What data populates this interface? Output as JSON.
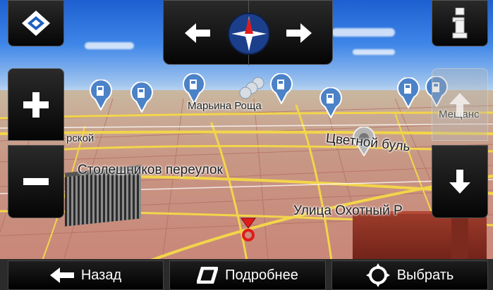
{
  "map": {
    "labels": {
      "marina_roshcha": "Марьина Роща",
      "meshchansky": "Мещанс",
      "left_partial": "рской",
      "tsvetnoy": "Цветной буль",
      "stoleshnikov": "Столешников переулок",
      "okhotny": "Улица Охотный Р"
    }
  },
  "nav": {
    "bottom": {
      "back_label": "Назад",
      "details_label": "Подробнее",
      "select_label": "Выбрать"
    }
  },
  "icons": {
    "menu": "menu-logo-icon",
    "info": "info-icon",
    "zoom_in": "plus-icon",
    "zoom_out": "minus-icon",
    "compass": "compass-icon",
    "rotate_left": "arrow-left-icon",
    "rotate_right": "arrow-right-icon",
    "tilt_up": "arrow-up-icon",
    "tilt_down": "arrow-down-icon",
    "poi": "fuel-station-icon",
    "cursor": "map-cursor-icon"
  },
  "colors": {
    "road": "#f2d54a",
    "panel": "#111111",
    "cursor": "#e01b1b",
    "poi": "#4b82c8"
  }
}
